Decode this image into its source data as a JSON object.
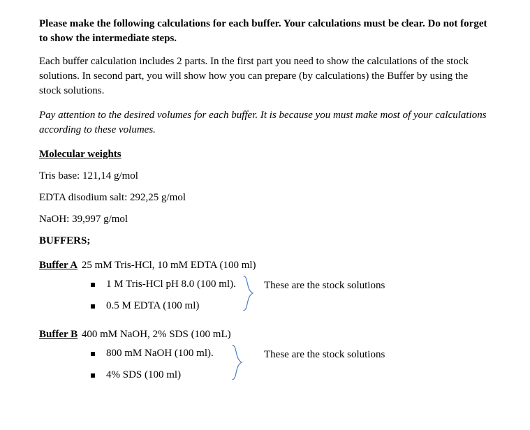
{
  "heading": "Please make the following calculations for each buffer. Your calculations must be clear. Do not forget to show the intermediate steps.",
  "para1": "Each buffer calculation includes 2 parts. In the first part you need to show the calculations of the stock solutions. In second part, you will show how you can prepare (by calculations) the Buffer by using the stock solutions.",
  "para2": "Pay attention to the desired volumes for each buffer. It is because you must make most of your calculations according to these volumes.",
  "mw": {
    "title": "Molecular weights",
    "items": [
      "Tris base: 121,14 g/mol",
      "EDTA disodium salt: 292,25 g/mol",
      "NaOH: 39,997 g/mol"
    ]
  },
  "buffers_title": "BUFFERS;",
  "bufferA": {
    "label": "Buffer A",
    "spec": " 25 mM Tris-HCl, 10 mM EDTA (100 ml)",
    "bullets": [
      "1 M Tris-HCl pH 8.0 (100 ml).",
      "0.5 M EDTA (100 ml)"
    ],
    "note": "These are the stock solutions"
  },
  "bufferB": {
    "label": "Buffer B",
    "spec": " 400 mM NaOH, 2% SDS (100 mL)",
    "bullets": [
      "800 mM NaOH (100 ml).",
      "4% SDS (100 ml)"
    ],
    "note": "These are the stock solutions"
  }
}
